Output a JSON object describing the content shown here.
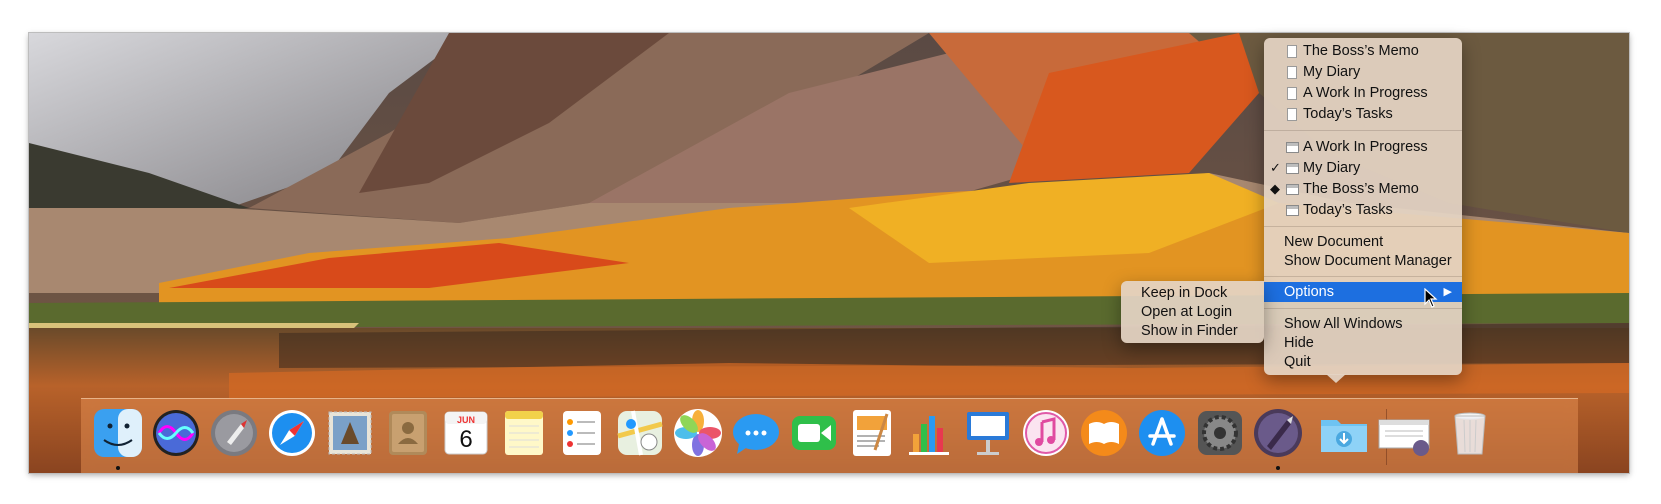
{
  "dock": {
    "apps": [
      {
        "name": "Finder",
        "running": true
      },
      {
        "name": "Siri",
        "running": false
      },
      {
        "name": "Launchpad",
        "running": false
      },
      {
        "name": "Safari",
        "running": false
      },
      {
        "name": "Mail",
        "running": false
      },
      {
        "name": "Contacts",
        "running": false
      },
      {
        "name": "Calendar",
        "running": false,
        "month": "JUN",
        "day": "6"
      },
      {
        "name": "Notes",
        "running": false
      },
      {
        "name": "Reminders",
        "running": false
      },
      {
        "name": "Maps",
        "running": false
      },
      {
        "name": "Photos",
        "running": false
      },
      {
        "name": "Messages",
        "running": false
      },
      {
        "name": "FaceTime",
        "running": false
      },
      {
        "name": "Pages",
        "running": false
      },
      {
        "name": "Numbers",
        "running": false
      },
      {
        "name": "Keynote",
        "running": false
      },
      {
        "name": "iTunes",
        "running": false
      },
      {
        "name": "iBooks",
        "running": false
      },
      {
        "name": "App Store",
        "running": false
      },
      {
        "name": "System Preferences",
        "running": false
      },
      {
        "name": "Writing App",
        "running": true
      }
    ],
    "right_items": [
      "Downloads",
      "Document Stack",
      "Trash"
    ]
  },
  "context_menu": {
    "recent_documents": [
      "The Boss’s Memo",
      "My Diary",
      "A Work In Progress",
      "Today’s Tasks"
    ],
    "open_windows": [
      {
        "label": "A Work In Progress",
        "mark": ""
      },
      {
        "label": "My Diary",
        "mark": "✓"
      },
      {
        "label": "The Boss’s Memo",
        "mark": "◆"
      },
      {
        "label": "Today’s Tasks",
        "mark": ""
      }
    ],
    "new_document": "New Document",
    "show_document_manager": "Show Document Manager",
    "options": "Options",
    "options_arrow": "▶",
    "show_all_windows": "Show All Windows",
    "hide": "Hide",
    "quit": "Quit"
  },
  "options_submenu": {
    "keep_in_dock": "Keep in Dock",
    "open_at_login": "Open at Login",
    "show_in_finder": "Show in Finder"
  },
  "colors": {
    "highlight": "#1d6fe0"
  }
}
